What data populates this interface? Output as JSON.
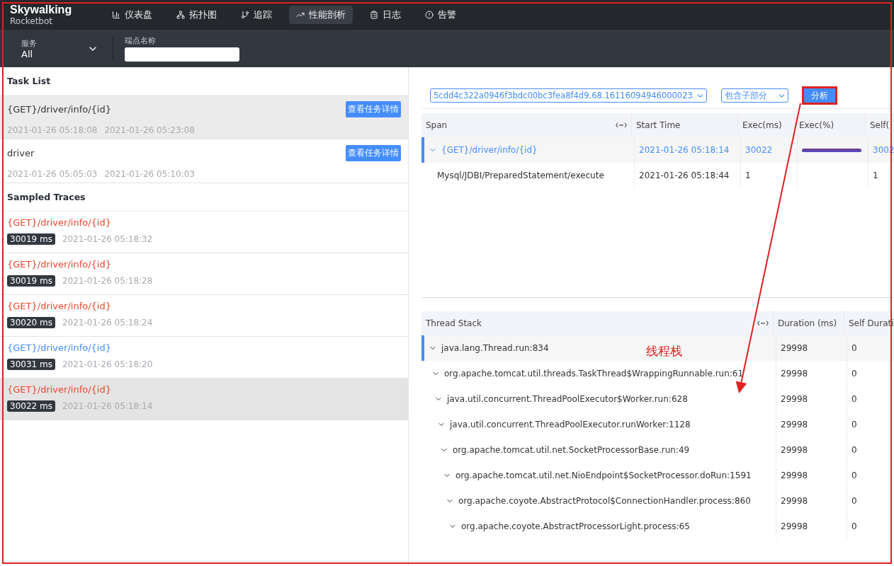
{
  "logo": {
    "name": "Skywalking",
    "subtitle": "Rocketbot"
  },
  "nav": [
    {
      "label": "仪表盘",
      "kind": "chart",
      "selected": false
    },
    {
      "label": "拓扑图",
      "kind": "topology",
      "selected": false
    },
    {
      "label": "追踪",
      "kind": "trace",
      "selected": false
    },
    {
      "label": "性能剖析",
      "kind": "trend",
      "selected": true
    },
    {
      "label": "日志",
      "kind": "log",
      "selected": false
    },
    {
      "label": "告警",
      "kind": "alert",
      "selected": false
    }
  ],
  "filters": {
    "service": {
      "label": "服务",
      "value": "All"
    },
    "endpoint": {
      "label": "端点名称"
    }
  },
  "task_list": {
    "title": "Task List",
    "tasks": [
      {
        "name": "{GET}/driver/info/{id}",
        "start": "2021-01-26 05:18:08",
        "end": "2021-01-26 05:23:08",
        "button": "查看任务详情",
        "selected": true
      },
      {
        "name": "driver",
        "start": "2021-01-26 05:05:03",
        "end": "2021-01-26 05:10:03",
        "button": "查看任务详情",
        "selected": false
      }
    ]
  },
  "sampled_traces": {
    "title": "Sampled Traces",
    "traces": [
      {
        "endpoint": "{GET}/driver/info/{id}",
        "duration": "30019 ms",
        "time": "2021-01-26 05:18:32",
        "error": true,
        "selected": false
      },
      {
        "endpoint": "{GET}/driver/info/{id}",
        "duration": "30019 ms",
        "time": "2021-01-26 05:18:28",
        "error": true,
        "selected": false
      },
      {
        "endpoint": "{GET}/driver/info/{id}",
        "duration": "30020 ms",
        "time": "2021-01-26 05:18:24",
        "error": true,
        "selected": false
      },
      {
        "endpoint": "{GET}/driver/info/{id}",
        "duration": "30031 ms",
        "time": "2021-01-26 05:18:20",
        "error": false,
        "selected": false
      },
      {
        "endpoint": "{GET}/driver/info/{id}",
        "duration": "30022 ms",
        "time": "2021-01-26 05:18:14",
        "error": true,
        "selected": true
      }
    ]
  },
  "analysis": {
    "trace_id": "5cdd4c322a0946f3bdc00bc3fea8f4d9.68.16116094946000023",
    "mode": "包含子部分",
    "button": "分析"
  },
  "span_table": {
    "columns": [
      "Span",
      "Start Time",
      "Exec(ms)",
      "Exec(%)",
      "Self("
    ],
    "rows": [
      {
        "span": "{GET}/driver/info/{id}",
        "start": "2021-01-26 05:18:14",
        "exec": "30022",
        "level": 1,
        "self": "3002",
        "selected": true,
        "expanded": true,
        "children": [
          {
            "span": "Mysql/JDBI/PreparedStatement/execute",
            "start": "2021-01-26 05:18:44",
            "exec": "1",
            "self": "1",
            "selected": false
          }
        ]
      }
    ]
  },
  "thread_stack": {
    "columns": [
      "Thread Stack",
      "Duration (ms)",
      "Self Durati"
    ],
    "rows": [
      {
        "code": "java.lang.Thread.run:834",
        "duration": "29998",
        "self": "0",
        "selected": true,
        "expanded": true,
        "children": [
          {
            "code": "org.apache.tomcat.util.threads.TaskThread$WrappingRunnable.run:61",
            "duration": "29998",
            "self": "0",
            "selected": false,
            "expanded": true,
            "children": [
              {
                "code": "java.util.concurrent.ThreadPoolExecutor$Worker.run:628",
                "duration": "29998",
                "self": "0",
                "selected": false,
                "expanded": true,
                "children": [
                  {
                    "code": "java.util.concurrent.ThreadPoolExecutor.runWorker:1128",
                    "duration": "29998",
                    "self": "0",
                    "selected": false,
                    "expanded": true,
                    "children": [
                      {
                        "code": "org.apache.tomcat.util.net.SocketProcessorBase.run:49",
                        "duration": "29998",
                        "self": "0",
                        "selected": false,
                        "expanded": true,
                        "children": [
                          {
                            "code": "org.apache.tomcat.util.net.NioEndpoint$SocketProcessor.doRun:1591",
                            "duration": "29998",
                            "self": "0",
                            "selected": false,
                            "expanded": true,
                            "children": [
                              {
                                "code": "org.apache.coyote.AbstractProtocol$ConnectionHandler.process:860",
                                "duration": "29998",
                                "self": "0",
                                "selected": false,
                                "expanded": true,
                                "children": [
                                  {
                                    "code": "org.apache.coyote.AbstractProcessorLight.process:65",
                                    "duration": "29998",
                                    "self": "0",
                                    "selected": false,
                                    "expanded": true
                                  }
                                ]
                              }
                            ]
                          }
                        ]
                      }
                    ]
                  }
                ]
              }
            ]
          }
        ]
      }
    ]
  },
  "annotation": {
    "label": "线程栈"
  }
}
